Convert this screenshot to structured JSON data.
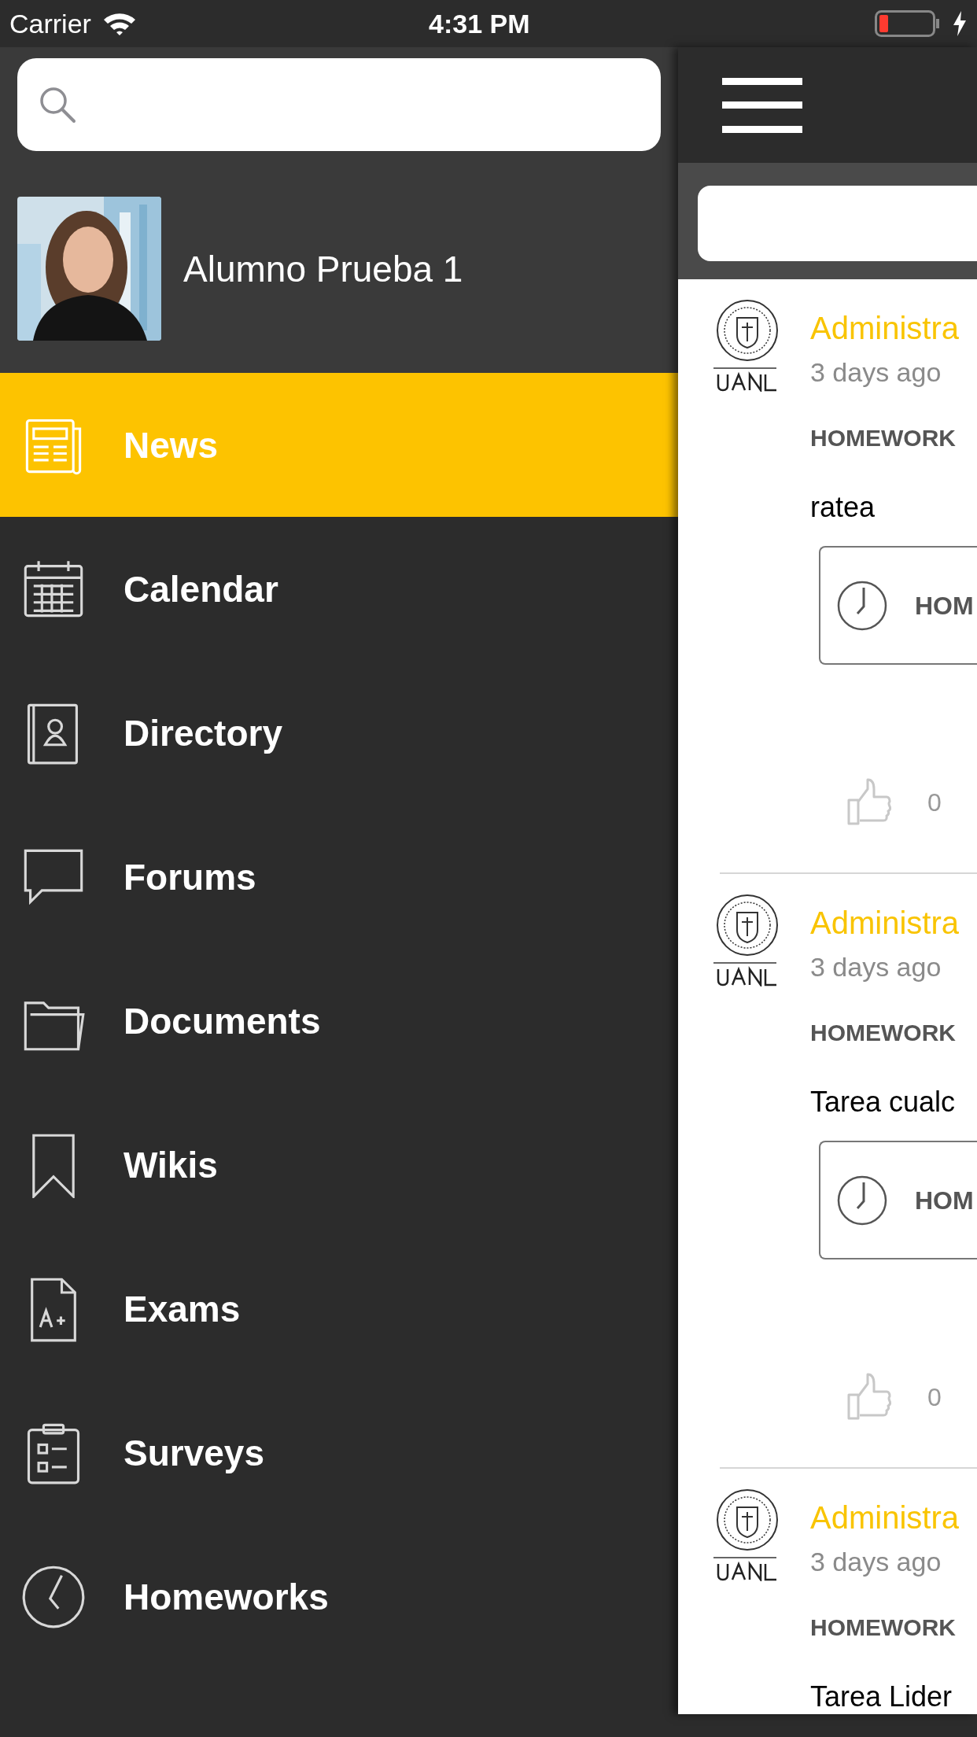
{
  "status_bar": {
    "carrier": "Carrier",
    "time": "4:31 PM"
  },
  "drawer": {
    "profile": {
      "name": "Alumno Prueba 1"
    },
    "menu": [
      {
        "label": "News",
        "selected": true
      },
      {
        "label": "Calendar",
        "selected": false
      },
      {
        "label": "Directory",
        "selected": false
      },
      {
        "label": "Forums",
        "selected": false
      },
      {
        "label": "Documents",
        "selected": false
      },
      {
        "label": "Wikis",
        "selected": false
      },
      {
        "label": "Exams",
        "selected": false
      },
      {
        "label": "Surveys",
        "selected": false
      },
      {
        "label": "Homeworks",
        "selected": false
      }
    ]
  },
  "feed": {
    "posts": [
      {
        "author": "Administra",
        "time": "3 days ago",
        "category": "HOMEWORK",
        "body": "ratea",
        "attachment": "HOM",
        "likes": "0"
      },
      {
        "author": "Administra",
        "time": "3 days ago",
        "category": "HOMEWORK",
        "body": "Tarea cualc",
        "attachment": "HOM",
        "likes": "0"
      },
      {
        "author": "Administra",
        "time": "3 days ago",
        "category": "HOMEWORK",
        "body": "Tarea Lider"
      }
    ]
  }
}
